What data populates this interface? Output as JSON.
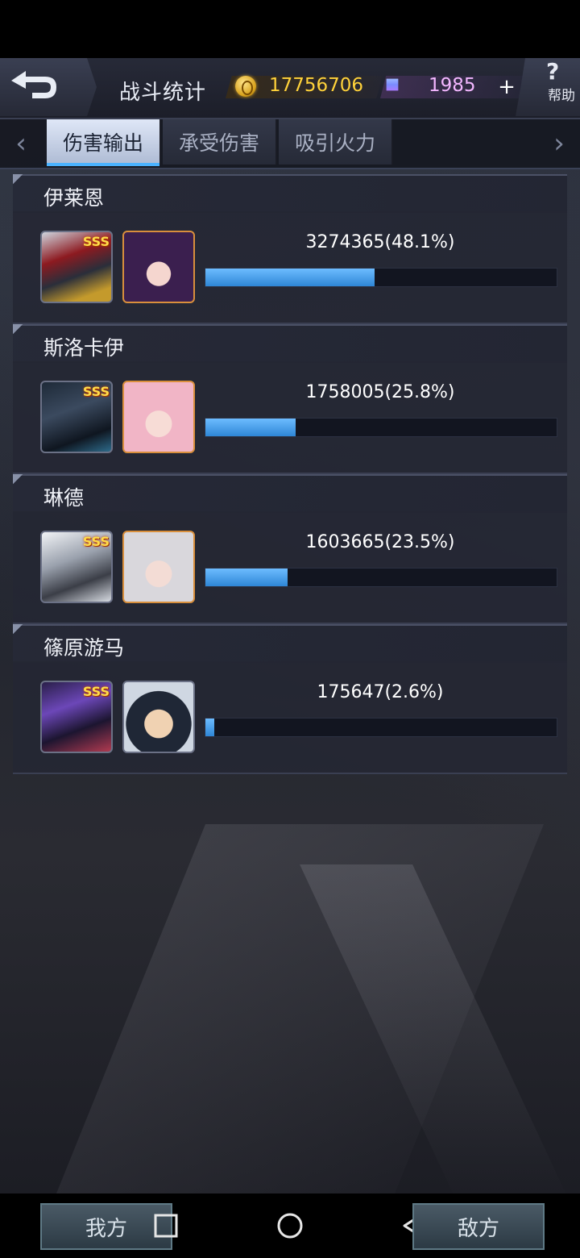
{
  "header": {
    "title": "战斗统计",
    "gold": "17756706",
    "gems": "1985",
    "plus": "+",
    "help_q": "?",
    "help_label": "帮助"
  },
  "tabs": [
    {
      "label": "伤害输出",
      "active": true
    },
    {
      "label": "承受伤害",
      "active": false
    },
    {
      "label": "吸引火力",
      "active": false
    }
  ],
  "arrows": {
    "left": "‹",
    "right": "›"
  },
  "rows": [
    {
      "name": "伊莱恩",
      "rank": "SSS",
      "value": "3274365(48.1%)",
      "percent": 48.1
    },
    {
      "name": "斯洛卡伊",
      "rank": "SSS",
      "value": "1758005(25.8%)",
      "percent": 25.8
    },
    {
      "name": "琳德",
      "rank": "SSS",
      "value": "1603665(23.5%)",
      "percent": 23.5
    },
    {
      "name": "篠原游马",
      "rank": "SSS",
      "value": "175647(2.6%)",
      "percent": 2.6
    }
  ],
  "bottom": {
    "our_label": "我方",
    "enemy_label": "敌方"
  },
  "colors": {
    "bar_fill": "#2e86d6",
    "gold_text": "#ffd23a",
    "gem_text": "#f3b7ff",
    "active_tab": "#dfe7f7"
  }
}
